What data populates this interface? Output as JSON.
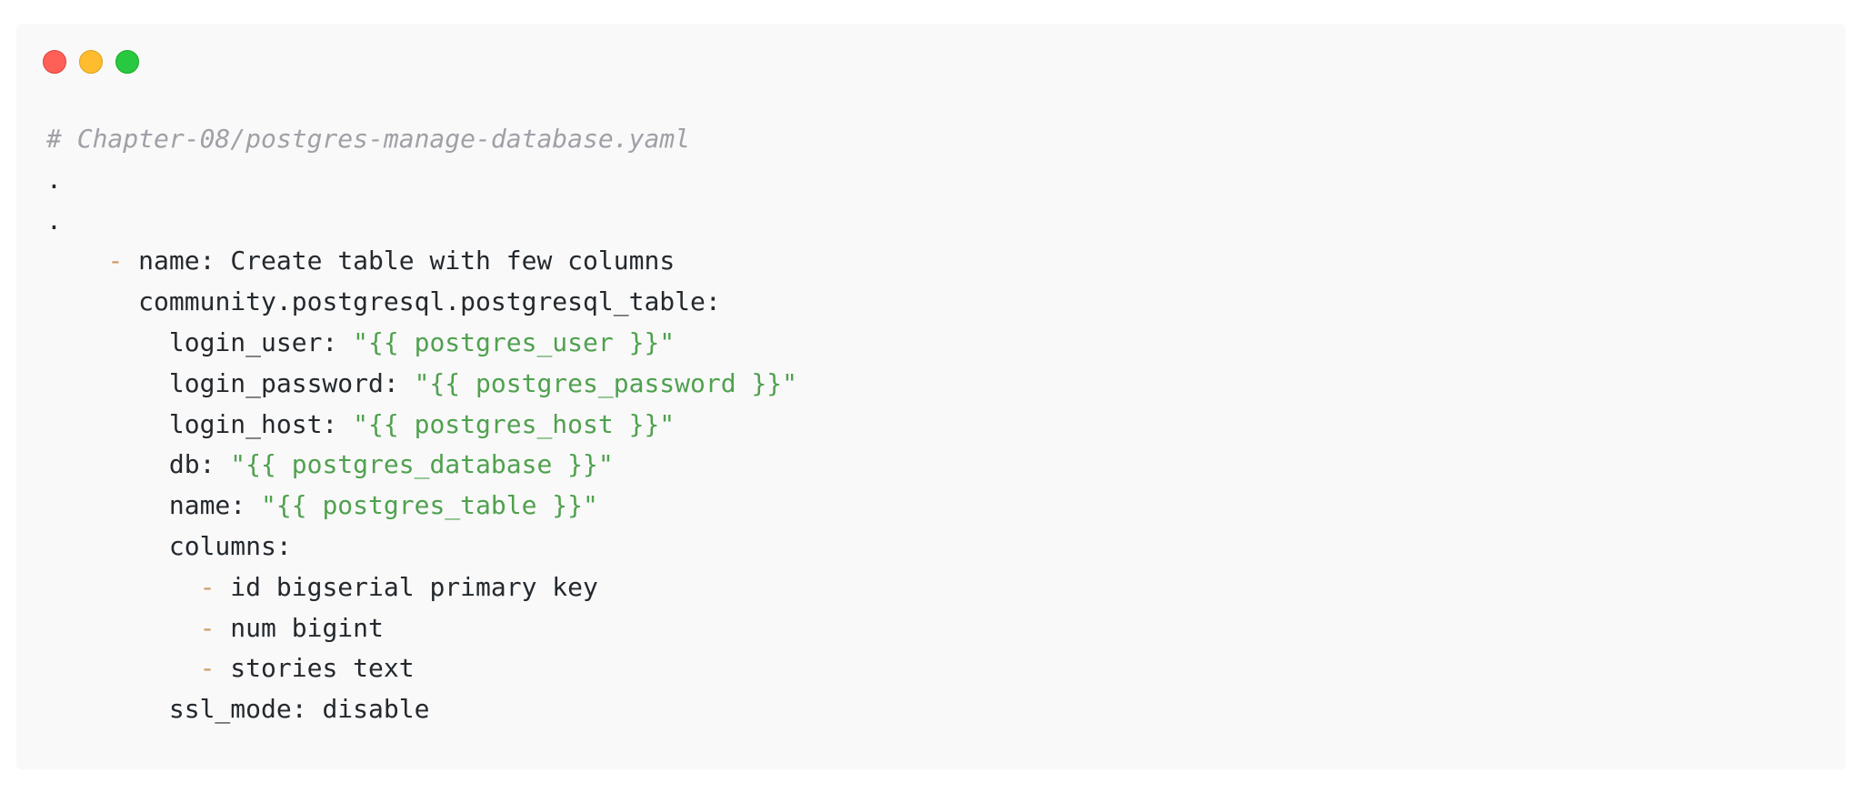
{
  "window": {
    "controls": [
      "close",
      "minimize",
      "maximize"
    ]
  },
  "code": {
    "language": "yaml",
    "lines": [
      {
        "indent": "",
        "comment": "# Chapter-08/postgres-manage-database.yaml"
      },
      {
        "indent": "",
        "text": "."
      },
      {
        "indent": "",
        "text": "."
      },
      {
        "indent": "    ",
        "dash": "-",
        "key": " name: ",
        "value": "Create table with few columns"
      },
      {
        "indent": "      ",
        "key": "community.postgresql.postgresql_table:"
      },
      {
        "indent": "        ",
        "key": "login_user: ",
        "str": "\"{{ postgres_user }}\""
      },
      {
        "indent": "        ",
        "key": "login_password: ",
        "str": "\"{{ postgres_password }}\""
      },
      {
        "indent": "        ",
        "key": "login_host: ",
        "str": "\"{{ postgres_host }}\""
      },
      {
        "indent": "        ",
        "key": "db: ",
        "str": "\"{{ postgres_database }}\""
      },
      {
        "indent": "        ",
        "key": "name: ",
        "str": "\"{{ postgres_table }}\""
      },
      {
        "indent": "        ",
        "key": "columns:"
      },
      {
        "indent": "          ",
        "dash": "-",
        "value": " id bigserial primary key"
      },
      {
        "indent": "          ",
        "dash": "-",
        "value": " num bigint"
      },
      {
        "indent": "          ",
        "dash": "-",
        "value": " stories text"
      },
      {
        "indent": "        ",
        "key": "ssl_mode: ",
        "value": "disable"
      }
    ]
  },
  "colors": {
    "background": "#f9f9f9",
    "text": "#24292e",
    "comment": "#a0a1a7",
    "dash": "#d19a66",
    "string": "#50a14f"
  }
}
